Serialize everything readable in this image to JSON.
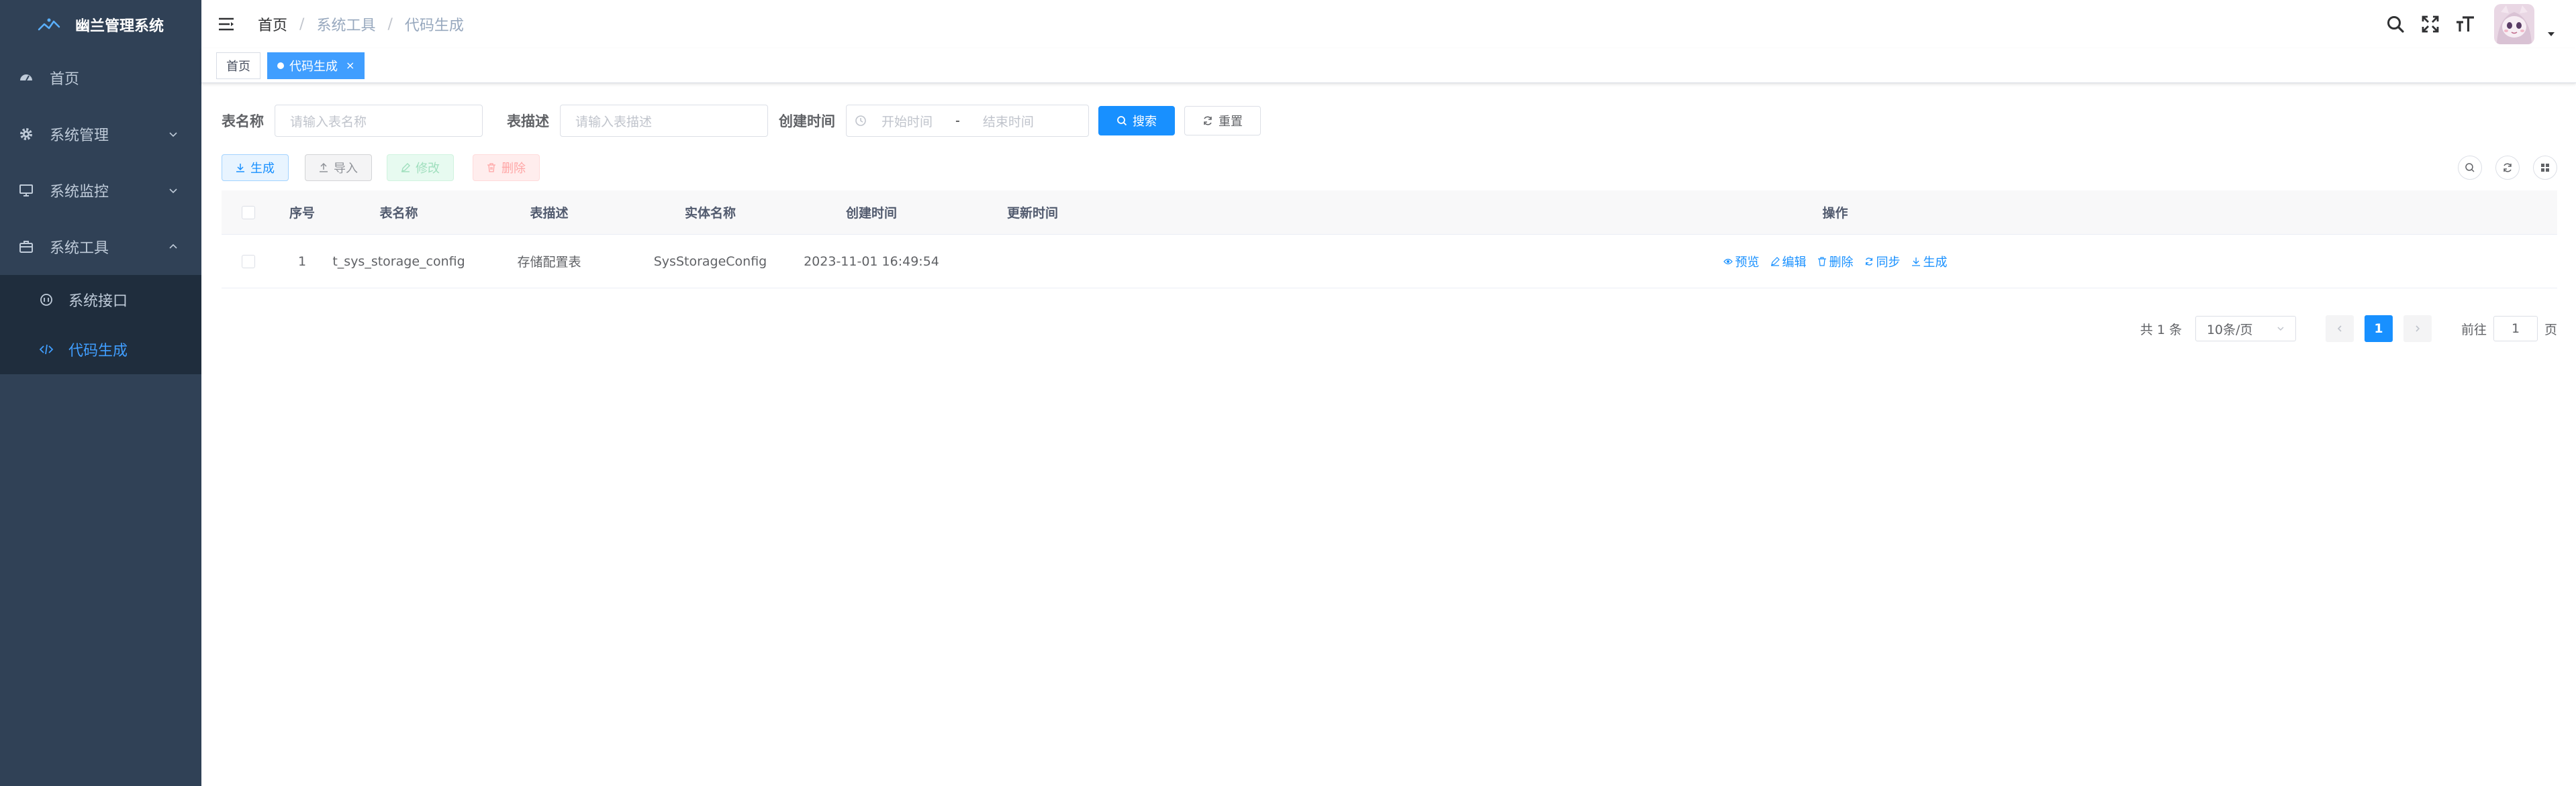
{
  "sidebar": {
    "title": "幽兰管理系统",
    "items": [
      {
        "label": "首页",
        "icon": "dashboard-icon"
      },
      {
        "label": "系统管理",
        "icon": "gear-icon"
      },
      {
        "label": "系统监控",
        "icon": "monitor-icon"
      },
      {
        "label": "系统工具",
        "icon": "toolbox-icon"
      }
    ],
    "subitems": [
      {
        "label": "系统接口",
        "icon": "api-icon"
      },
      {
        "label": "代码生成",
        "icon": "code-icon"
      }
    ]
  },
  "navbar": {
    "breadcrumb": [
      "首页",
      "系统工具",
      "代码生成"
    ]
  },
  "tags": [
    {
      "label": "首页"
    },
    {
      "label": "代码生成",
      "close": "×"
    }
  ],
  "search": {
    "table_name_label": "表名称",
    "table_name_placeholder": "请输入表名称",
    "table_desc_label": "表描述",
    "table_desc_placeholder": "请输入表描述",
    "create_time_label": "创建时间",
    "start_placeholder": "开始时间",
    "range_sep": "-",
    "end_placeholder": "结束时间",
    "search_btn": "搜索",
    "reset_btn": "重置"
  },
  "toolbar": {
    "generate": "生成",
    "import": "导入",
    "edit": "修改",
    "delete": "删除"
  },
  "table": {
    "columns": [
      "序号",
      "表名称",
      "表描述",
      "实体名称",
      "创建时间",
      "更新时间",
      "操作"
    ],
    "rows": [
      {
        "index": "1",
        "table_name": "t_sys_storage_config",
        "table_desc": "存储配置表",
        "entity": "SysStorageConfig",
        "create_time": "2023-11-01 16:49:54",
        "update_time": ""
      }
    ],
    "actions": [
      "预览",
      "编辑",
      "删除",
      "同步",
      "生成"
    ]
  },
  "pagination": {
    "total": "共 1 条",
    "page_size": "10条/页",
    "current": "1",
    "goto_label": "前往",
    "goto_value": "1",
    "page_suffix": "页"
  },
  "colors": {
    "sidebar_bg": "#304156",
    "submenu_bg": "#1f2d3d",
    "primary": "#1890ff",
    "active_menu": "#409eff"
  }
}
